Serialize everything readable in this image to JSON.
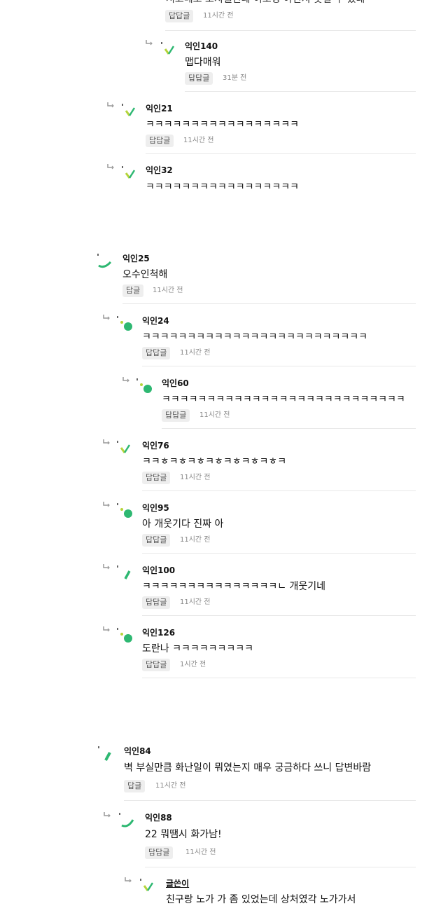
{
  "comments": [
    {
      "nick": "",
      "text": "서코메오 오지겔인데 이오징 아진지 웃길 수 였네",
      "reply_label": "답답글",
      "time": "11시간 전"
    },
    {
      "nick": "익인140",
      "text": "맵다매워",
      "reply_label": "답답글",
      "time": "31분 전"
    },
    {
      "nick": "익인21",
      "text": "ㅋㅋㅋㅋㅋㅋㅋㅋㅋㅋㅋㅋㅋㅋㅋㅋㅋ",
      "reply_label": "답답글",
      "time": "11시간 전"
    },
    {
      "nick": "익인32",
      "text": "ㅋㅋㅋㅋㅋㅋㅋㅋㅋㅋㅋㅋㅋㅋㅋㅋㅋ"
    },
    {
      "nick": "익인25",
      "text": "오수인척해",
      "reply_label": "답글",
      "time": "11시간 전"
    },
    {
      "nick": "익인24",
      "text": "ㅋㅋㅋㅋㅋㅋㅋㅋㅋㅋㅋㅋㅋㅋㅋㅋㅋㅋㅋㅋㅋㅋㅋㅋㅋ",
      "reply_label": "답답글",
      "time": "11시간 전"
    },
    {
      "nick": "익인60",
      "text": "ㅋㅋㅋㅋㅋㅋㅋㅋㅋㅋㅋㅋㅋㅋㅋㅋㅋㅋㅋㅋㅋㅋㅋㅋㅋㅋㅋ",
      "reply_label": "답답글",
      "time": "11시간 전"
    },
    {
      "nick": "익인76",
      "text": "ㅋㅋㅎㅋㅎㅋㅎㅋㅎㅋㅎㅋㅎㅋㅎㅋ",
      "reply_label": "답답글",
      "time": "11시간 전"
    },
    {
      "nick": "익인95",
      "text": "아 개웃기다 진짜 아",
      "reply_label": "답답글",
      "time": "11시간 전"
    },
    {
      "nick": "익인100",
      "text": "ㅋㅋㅋㅋㅋㅋㅋㅋㅋㅋㅋㅋㅋㅋㅋㄴ 개웃기네",
      "reply_label": "답답글",
      "time": "11시간 전"
    },
    {
      "nick": "익인126",
      "text": "도란나 ㅋㅋㅋㅋㅋㅋㅋㅋㅋ",
      "reply_label": "답답글",
      "time": "1시간 전"
    },
    {
      "nick": "익인84",
      "text": "벽 부실만큼 화난일이 뭐였는지 매우 궁금하다 쓰니 답변바람",
      "reply_label": "답글",
      "time": "11시간 전"
    },
    {
      "nick": "익인88",
      "text": "22 뭐땜시 화가남!",
      "reply_label": "답답글",
      "time": "11시간 전"
    },
    {
      "nick": "글쓴이",
      "text": "친구랑 노가 가 좀 있었는데 상처였각 노가가서"
    }
  ],
  "colors": {
    "accent_green": "#2eb872",
    "lime": "#b5d43a",
    "reply_bg": "#eeeeee"
  }
}
